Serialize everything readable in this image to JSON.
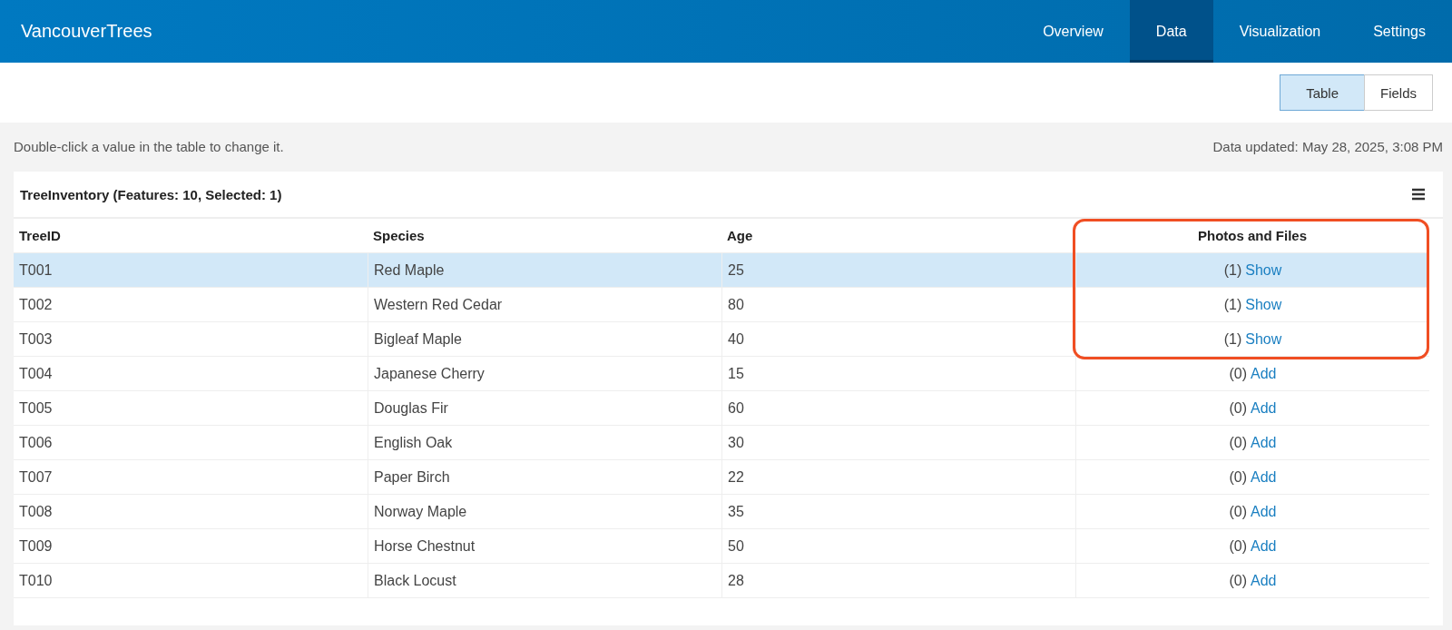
{
  "app_title": "VancouverTrees",
  "nav": [
    {
      "label": "Overview",
      "selected": false
    },
    {
      "label": "Data",
      "selected": true
    },
    {
      "label": "Visualization",
      "selected": false
    },
    {
      "label": "Settings",
      "selected": false
    }
  ],
  "view_toggle": [
    {
      "label": "Table",
      "selected": true
    },
    {
      "label": "Fields",
      "selected": false
    }
  ],
  "hint": "Double-click a value in the table to change it.",
  "updated": "Data updated: May 28, 2025, 3:08 PM",
  "table": {
    "title": "TreeInventory (Features: 10, Selected: 1)",
    "columns": [
      {
        "label": "TreeID",
        "highlighted": false
      },
      {
        "label": "Species",
        "highlighted": false
      },
      {
        "label": "Age",
        "highlighted": false
      },
      {
        "label": "Photos and Files",
        "highlighted": true
      }
    ],
    "rows": [
      {
        "id": "T001",
        "species": "Red Maple",
        "age": "25",
        "count": "(1)",
        "action": "Show",
        "selected": true,
        "highlighted": true
      },
      {
        "id": "T002",
        "species": "Western Red Cedar",
        "age": "80",
        "count": "(1)",
        "action": "Show",
        "selected": false,
        "highlighted": true
      },
      {
        "id": "T003",
        "species": "Bigleaf Maple",
        "age": "40",
        "count": "(1)",
        "action": "Show",
        "selected": false,
        "highlighted": true
      },
      {
        "id": "T004",
        "species": "Japanese Cherry",
        "age": "15",
        "count": "(0)",
        "action": "Add",
        "selected": false,
        "highlighted": false
      },
      {
        "id": "T005",
        "species": "Douglas Fir",
        "age": "60",
        "count": "(0)",
        "action": "Add",
        "selected": false,
        "highlighted": false
      },
      {
        "id": "T006",
        "species": "English Oak",
        "age": "30",
        "count": "(0)",
        "action": "Add",
        "selected": false,
        "highlighted": false
      },
      {
        "id": "T007",
        "species": "Paper Birch",
        "age": "22",
        "count": "(0)",
        "action": "Add",
        "selected": false,
        "highlighted": false
      },
      {
        "id": "T008",
        "species": "Norway Maple",
        "age": "35",
        "count": "(0)",
        "action": "Add",
        "selected": false,
        "highlighted": false
      },
      {
        "id": "T009",
        "species": "Horse Chestnut",
        "age": "50",
        "count": "(0)",
        "action": "Add",
        "selected": false,
        "highlighted": false
      },
      {
        "id": "T010",
        "species": "Black Locust",
        "age": "28",
        "count": "(0)",
        "action": "Add",
        "selected": false,
        "highlighted": false
      }
    ]
  }
}
